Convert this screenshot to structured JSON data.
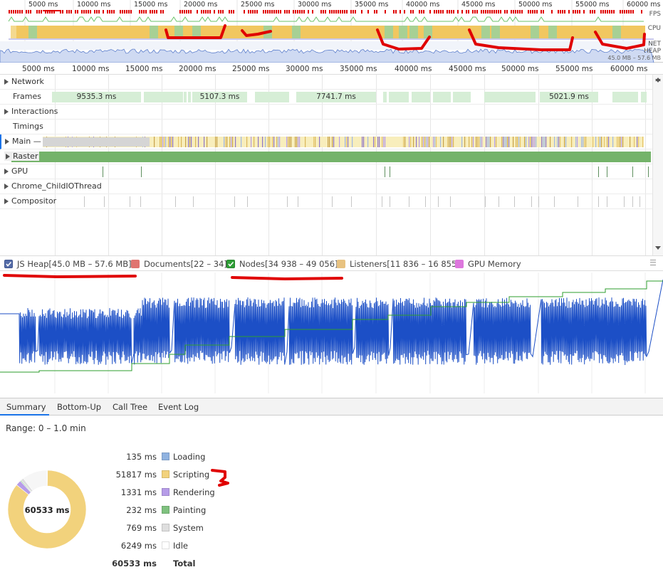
{
  "overview": {
    "ticks": [
      "5000 ms",
      "10000 ms",
      "15000 ms",
      "20000 ms",
      "25000 ms",
      "30000 ms",
      "35000 ms",
      "40000 ms",
      "45000 ms",
      "50000 ms",
      "55000 ms",
      "60000 ms"
    ],
    "labels": {
      "fps": "FPS",
      "cpu": "CPU",
      "net": "NET",
      "heap": "HEAP",
      "heap_range": "45.0 MB – 57.6 MB"
    }
  },
  "ruler": {
    "ticks": [
      "5000 ms",
      "10000 ms",
      "15000 ms",
      "20000 ms",
      "25000 ms",
      "30000 ms",
      "35000 ms",
      "40000 ms",
      "45000 ms",
      "50000 ms",
      "55000 ms",
      "60000 ms"
    ]
  },
  "tracks": {
    "network": "Network",
    "frames": "Frames",
    "interactions": "Interactions",
    "timings": "Timings",
    "main": "Main —",
    "raster": "Raster",
    "gpu": "GPU",
    "childio": "Chrome_ChildIOThread",
    "compositor": "Compositor"
  },
  "frames": [
    {
      "label": "9535.3 ms"
    },
    {
      "label": "5107.3 ms"
    },
    {
      "label": "7741.7 ms"
    },
    {
      "label": "5021.9 ms"
    }
  ],
  "counters": {
    "js_heap": "JS Heap[45.0 MB – 57.6 MB]",
    "documents": "Documents[22 – 34]",
    "nodes": "Nodes[34 938 – 49 056]",
    "listeners": "Listeners[11 836 – 16 855]",
    "gpu_memory": "GPU Memory"
  },
  "colors": {
    "js_heap": "#1c4fc6",
    "documents": "#e07470",
    "nodes": "#2e9e2e",
    "listeners": "#e8c280",
    "gpu_memory": "#dd77dd",
    "annotation": "#e00000"
  },
  "tabs": [
    "Summary",
    "Bottom-Up",
    "Call Tree",
    "Event Log"
  ],
  "summary": {
    "range": "Range: 0 – 1.0 min",
    "total_label": "60533 ms",
    "rows": [
      {
        "ms": "135 ms",
        "cat": "Loading",
        "color": "#8fb2e0"
      },
      {
        "ms": "51817 ms",
        "cat": "Scripting",
        "color": "#f2d27c"
      },
      {
        "ms": "1331 ms",
        "cat": "Rendering",
        "color": "#b69ce8"
      },
      {
        "ms": "232 ms",
        "cat": "Painting",
        "color": "#7fc17f"
      },
      {
        "ms": "769 ms",
        "cat": "System",
        "color": "#dedede"
      },
      {
        "ms": "6249 ms",
        "cat": "Idle",
        "color": "#ffffff"
      },
      {
        "ms": "60533 ms",
        "cat": "Total",
        "color": ""
      }
    ],
    "donut": [
      135,
      51817,
      1331,
      232,
      769,
      6249
    ]
  }
}
